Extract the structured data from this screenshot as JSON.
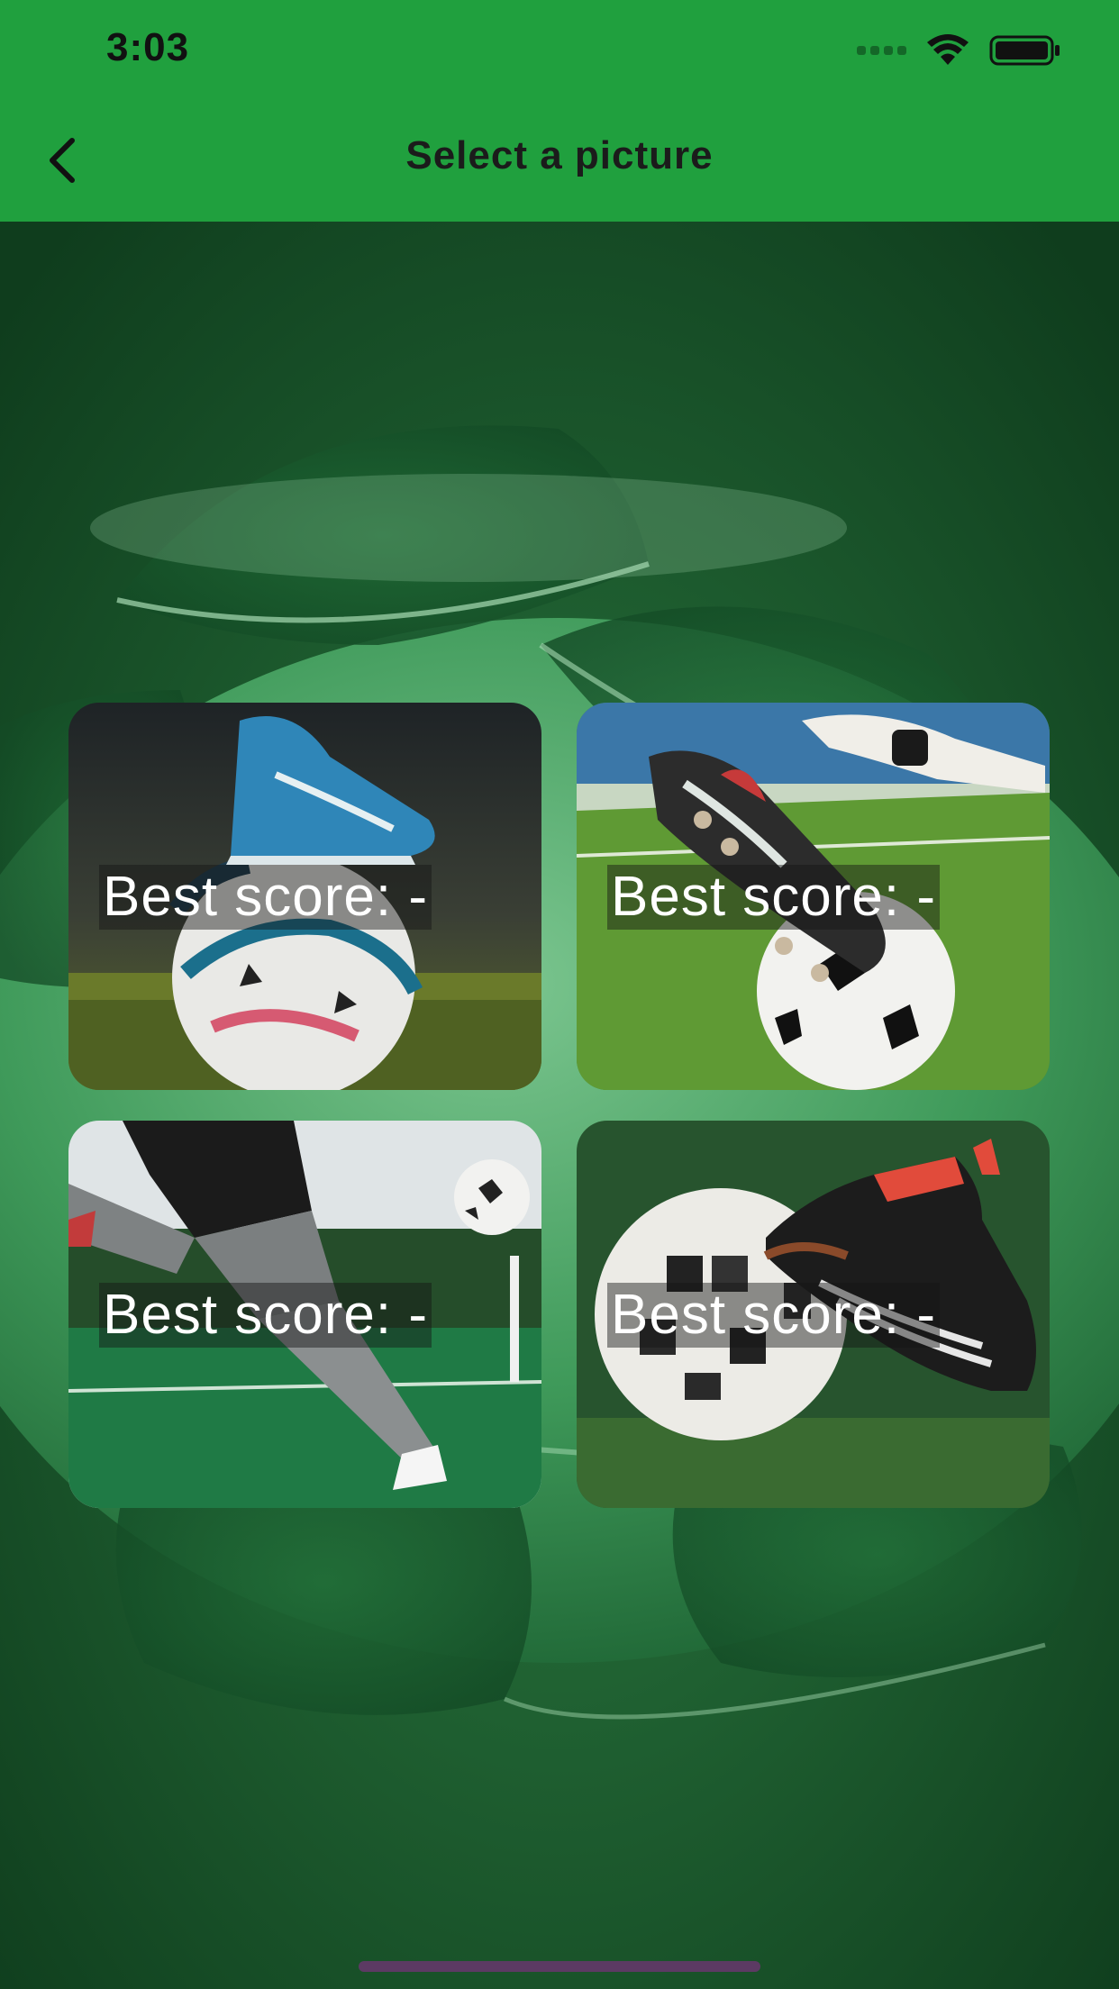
{
  "status_bar": {
    "time": "3:03"
  },
  "header": {
    "title": "Select a picture"
  },
  "cards": [
    {
      "score_label": "Best score: -",
      "scene": "foot on ball"
    },
    {
      "score_label": "Best score: -",
      "scene": "cleats with goalkeeper"
    },
    {
      "score_label": "Best score: -",
      "scene": "player kicking ball"
    },
    {
      "score_label": "Best score: -",
      "scene": "ball and black boots"
    }
  ],
  "colors": {
    "header": "#20a03e",
    "background": "#17532b",
    "ball_highlight": "#6dbb82",
    "text_on_card": "#ffffff"
  }
}
